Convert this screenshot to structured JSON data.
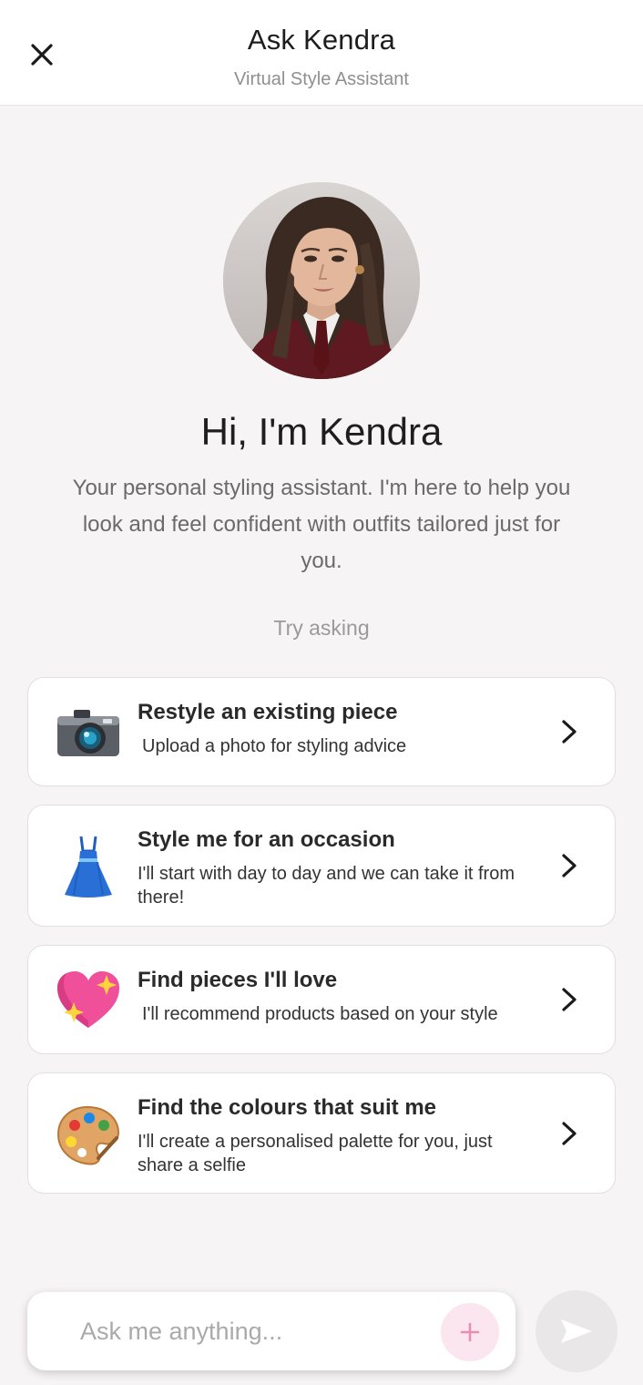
{
  "header": {
    "title": "Ask Kendra",
    "subtitle": "Virtual Style Assistant",
    "close_icon": "close-icon"
  },
  "intro": {
    "greeting": "Hi, I'm Kendra",
    "description": "Your personal styling assistant. I'm here to help you look and feel confident with outfits tailored just for you.",
    "try_asking": "Try asking"
  },
  "suggestions": [
    {
      "icon": "camera-icon",
      "title": "Restyle an existing piece",
      "description": "Upload a photo for styling advice"
    },
    {
      "icon": "dress-icon",
      "title": "Style me for an occasion",
      "description": "I'll start with day to day and we can take it from there!"
    },
    {
      "icon": "sparkling-heart-icon",
      "title": "Find pieces I'll love",
      "description": "I'll recommend products based on your style"
    },
    {
      "icon": "palette-icon",
      "title": "Find the colours that suit me",
      "description": "I'll create a personalised palette for you, just share a selfie"
    }
  ],
  "composer": {
    "placeholder": "Ask me anything...",
    "value": "",
    "plus_icon": "plus-icon",
    "send_icon": "send-icon"
  },
  "colors": {
    "accent_pink": "#e58fb4",
    "plus_bg": "#fbe6ef",
    "background": "#f7f4f5",
    "send_disabled": "#e9e7e8"
  }
}
